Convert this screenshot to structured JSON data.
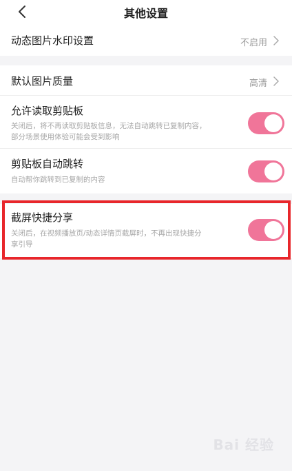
{
  "header": {
    "title": "其他设置",
    "back_icon": "chevron-left-icon"
  },
  "settings": {
    "watermark": {
      "label": "动态图片水印设置",
      "value": "不启用"
    },
    "image_quality": {
      "label": "默认图片质量",
      "value": "高清"
    },
    "clipboard_read": {
      "label": "允许读取剪贴板",
      "desc_line1": "关闭后，将不再读取剪贴板信息，无法自动跳转已复制内容，",
      "desc_line2": "部分场景使用体验可能会受到影响",
      "enabled": true
    },
    "clipboard_jump": {
      "label": "剪贴板自动跳转",
      "desc_line1": "自动帮你跳转到已复制的内容",
      "enabled": true
    },
    "screenshot_share": {
      "label": "截屏快捷分享",
      "desc_line1": "关闭后，在视频播放页/动态详情页截屏时，不再出现快捷分",
      "desc_line2": "享引导",
      "enabled": true
    }
  },
  "colors": {
    "toggle_on": "#f07599",
    "highlight_border": "#e8262b",
    "background": "#f4f4f6"
  },
  "watermark_text": "Bai 经验"
}
